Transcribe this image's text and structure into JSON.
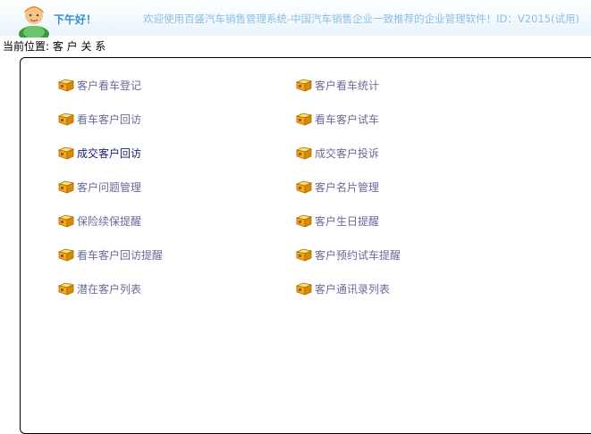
{
  "header": {
    "greeting": "下午好！",
    "welcome": "欢迎使用百盛汽车销售管理系统-中国汽车销售企业一致推荐的企业管理软件！ID：V2015(试用)"
  },
  "location": {
    "text": "当前位置: 客 户 关 系"
  },
  "colors": {
    "link": "#6a6a9c",
    "link_active": "#1a1a7a",
    "greeting": "#2f8fd0",
    "welcome": "#8bbfe4"
  },
  "menu": {
    "left": [
      {
        "label": "客户看车登记",
        "icon": "folder-icon"
      },
      {
        "label": "看车客户回访",
        "icon": "folder-icon"
      },
      {
        "label": "成交客户回访",
        "icon": "folder-icon"
      },
      {
        "label": "客户问题管理",
        "icon": "folder-icon"
      },
      {
        "label": "保险续保提醒",
        "icon": "folder-icon"
      },
      {
        "label": "看车客户回访提醒",
        "icon": "folder-icon"
      },
      {
        "label": "潜在客户列表",
        "icon": "folder-icon"
      }
    ],
    "right": [
      {
        "label": "客户看车统计",
        "icon": "folder-icon"
      },
      {
        "label": "看车客户试车",
        "icon": "folder-icon"
      },
      {
        "label": "成交客户投诉",
        "icon": "folder-icon"
      },
      {
        "label": "客户名片管理",
        "icon": "folder-icon"
      },
      {
        "label": "客户生日提醒",
        "icon": "folder-icon"
      },
      {
        "label": "客户预约试车提醒",
        "icon": "folder-icon"
      },
      {
        "label": "客户通讯录列表",
        "icon": "folder-icon"
      }
    ]
  }
}
